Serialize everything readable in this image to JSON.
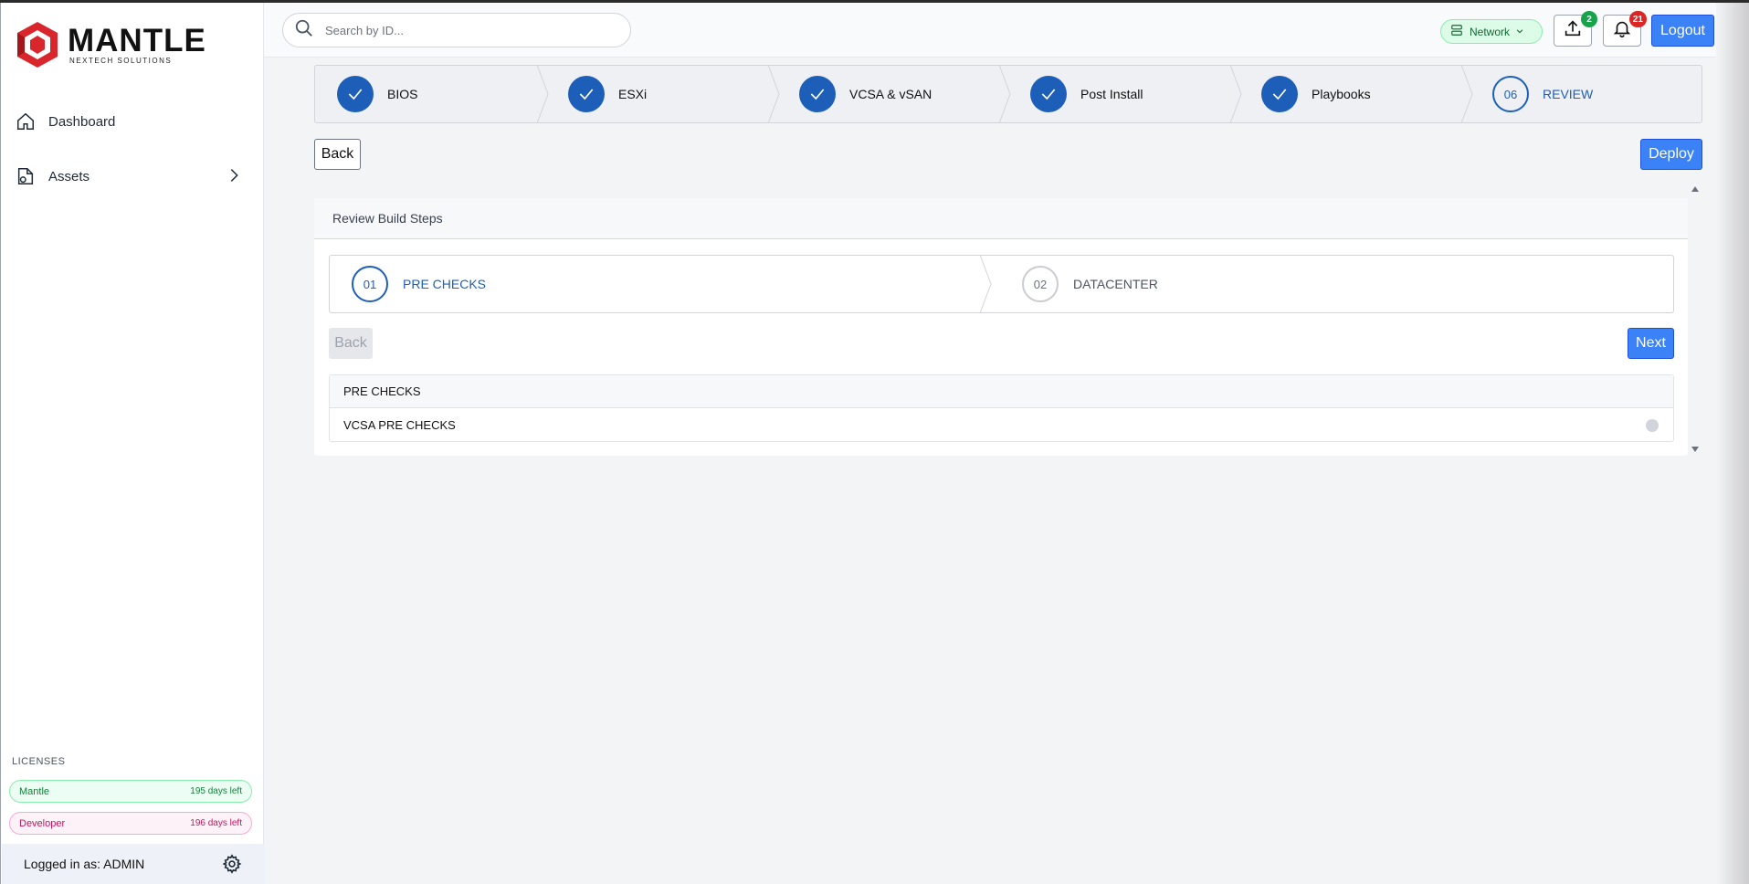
{
  "brand": {
    "name": "MANTLE",
    "tagline": "NEXTECH SOLUTIONS",
    "color": "#d9262c"
  },
  "sidebar": {
    "items": [
      {
        "label": "Dashboard",
        "icon": "home-icon"
      },
      {
        "label": "Assets",
        "icon": "assets-icon"
      }
    ],
    "licenses_label": "LICENSES",
    "licenses": [
      {
        "name": "Mantle",
        "days": "195 days left",
        "status": "green"
      },
      {
        "name": "Developer",
        "days": "196 days left",
        "status": "pink"
      }
    ],
    "user": "Logged in as: ADMIN"
  },
  "header": {
    "search_placeholder": "Search by ID...",
    "network_label": "Network",
    "upload_badge": "2",
    "notification_badge": "21",
    "logout_label": "Logout"
  },
  "wizard": {
    "steps": [
      {
        "label": "BIOS",
        "state": "done"
      },
      {
        "label": "ESXi",
        "state": "done"
      },
      {
        "label": "VCSA & vSAN",
        "state": "done"
      },
      {
        "label": "Post Install",
        "state": "done"
      },
      {
        "label": "Playbooks",
        "state": "done"
      },
      {
        "number": "06",
        "label": "REVIEW",
        "state": "active"
      }
    ],
    "back_label": "Back",
    "deploy_label": "Deploy"
  },
  "review": {
    "title": "Review Build Steps",
    "steps": [
      {
        "number": "01",
        "label": "PRE CHECKS",
        "state": "active"
      },
      {
        "number": "02",
        "label": "DATACENTER",
        "state": "idle"
      }
    ],
    "back_label": "Back",
    "next_label": "Next",
    "section_title": "PRE CHECKS",
    "checks": [
      {
        "label": "VCSA PRE CHECKS",
        "status": "pending"
      }
    ]
  },
  "colors": {
    "accent": "#1d5fb8",
    "button": "#3b82f6"
  }
}
